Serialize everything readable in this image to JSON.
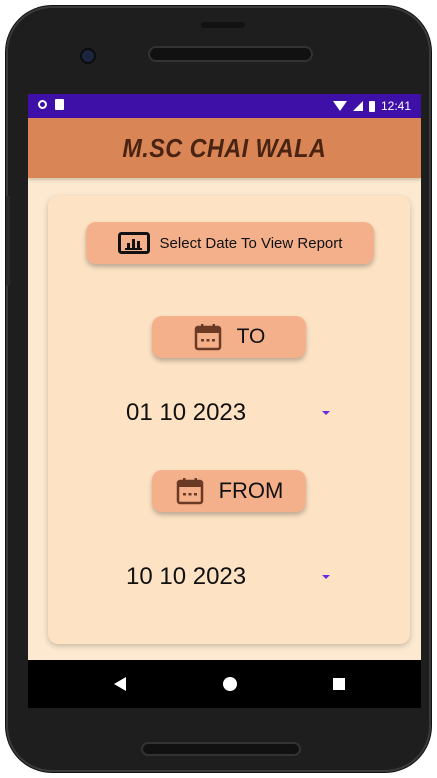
{
  "status_bar": {
    "time": "12:41",
    "icons": [
      "notification-circle-icon",
      "sim-card-icon",
      "wifi-icon",
      "signal-icon",
      "battery-icon"
    ]
  },
  "app": {
    "title": "M.SC CHAI WALA"
  },
  "report_button": {
    "label": "Select Date To View Report",
    "icon": "report-chart-icon"
  },
  "to_button": {
    "label": "TO",
    "icon": "calendar-icon"
  },
  "to_date": {
    "value": "01 10  2023"
  },
  "from_button": {
    "label": "FROM",
    "icon": "calendar-icon"
  },
  "from_date": {
    "value": "10 10  2023"
  },
  "colors": {
    "status_bar": "#3f10a8",
    "app_bar": "#d98555",
    "background": "#fde9cf",
    "card": "#fde2c4",
    "button": "#f4b08b",
    "dropdown_arrow": "#6a2ae0",
    "icon": "#6b3a24"
  },
  "nav_bar": {
    "buttons": [
      "back-icon",
      "home-icon",
      "recents-icon"
    ]
  }
}
